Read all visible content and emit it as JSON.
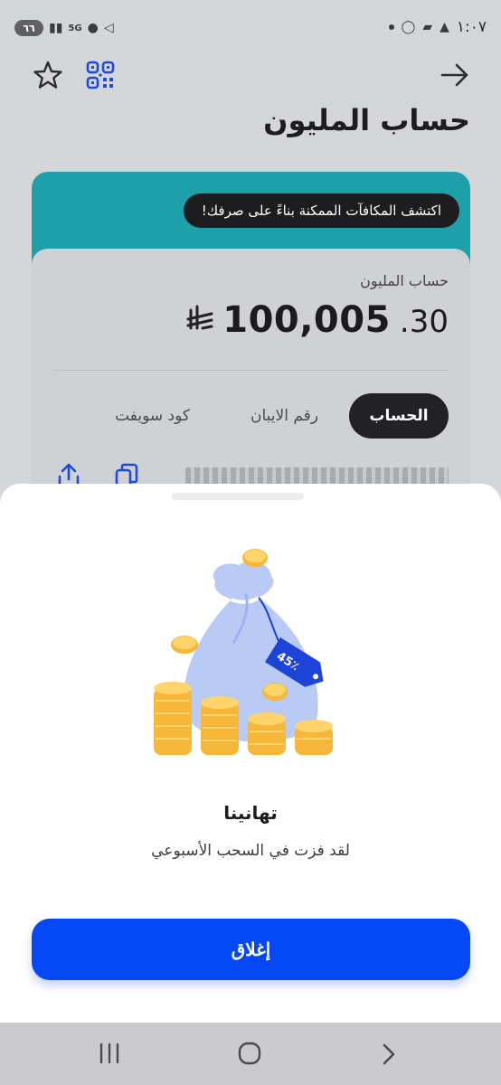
{
  "status_bar": {
    "battery": "٦٦",
    "network": "5G",
    "time": "١:٠٧"
  },
  "header": {
    "title": "حساب المليون",
    "icons": [
      "star-icon",
      "qr-code-icon",
      "back-arrow-icon"
    ]
  },
  "card": {
    "promo": "اكتشف المكافآت الممكنة بناءً على صرفك!",
    "account_label": "حساب المليون",
    "currency_symbol": "⃁",
    "amount_integer": "100,005",
    "amount_decimal": ".30",
    "tabs": [
      {
        "label": "الحساب",
        "active": true
      },
      {
        "label": "رقم الايبان",
        "active": false
      },
      {
        "label": "كود سويفت",
        "active": false
      }
    ],
    "icons": [
      "share-icon",
      "copy-icon"
    ]
  },
  "sheet": {
    "title": "تهانينا",
    "subtitle": "لقد فزت في السحب الأسبوعي",
    "tag_text": "45٪ ",
    "close_label": "إغلاق"
  },
  "colors": {
    "accent": "#0647f5",
    "teal": "#1ea0ab",
    "pill": "#1d1d20"
  }
}
